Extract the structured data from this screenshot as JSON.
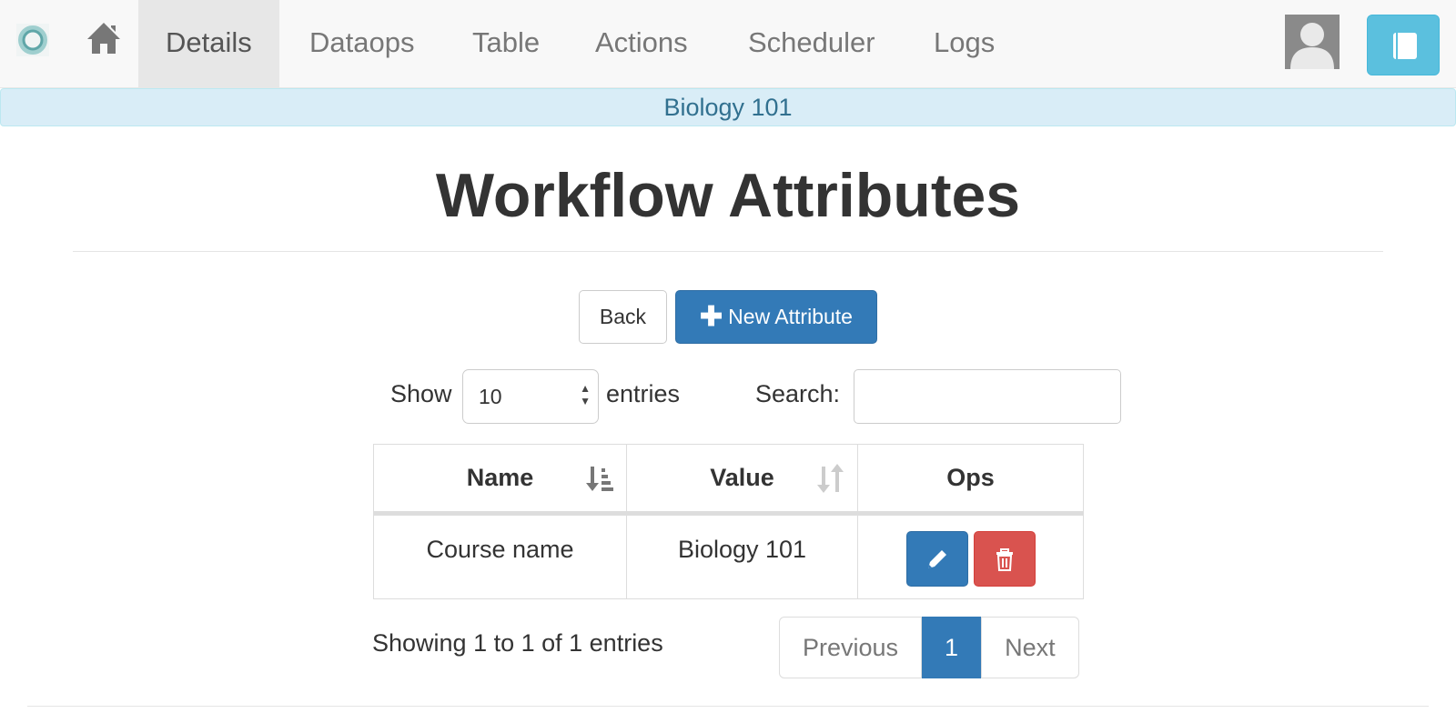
{
  "nav": {
    "brand_icon": "logo-ring-icon",
    "home_icon": "home-icon",
    "tabs": [
      "Details",
      "Dataops",
      "Table",
      "Actions",
      "Scheduler",
      "Logs"
    ],
    "active_tab": "Details",
    "avatar_icon": "user-avatar-icon",
    "doc_icon": "book-icon"
  },
  "context": {
    "workflow_name": "Biology 101"
  },
  "page": {
    "title": "Workflow Attributes"
  },
  "buttons": {
    "back": "Back",
    "new_attribute": "New Attribute"
  },
  "length": {
    "show_label": "Show",
    "value": "10",
    "entries_label": "entries"
  },
  "search": {
    "label": "Search:",
    "value": ""
  },
  "table": {
    "headers": [
      "Name",
      "Value",
      "Ops"
    ],
    "rows": [
      {
        "name": "Course name",
        "value": "Biology 101"
      }
    ]
  },
  "info": "Showing 1 to 1 of 1 entries",
  "pagination": {
    "previous": "Previous",
    "current": "1",
    "next": "Next"
  },
  "colors": {
    "primary": "#337ab7",
    "danger": "#d9534f",
    "info": "#5bc0de",
    "alert_bg": "#d9edf7",
    "alert_text": "#31708f"
  }
}
